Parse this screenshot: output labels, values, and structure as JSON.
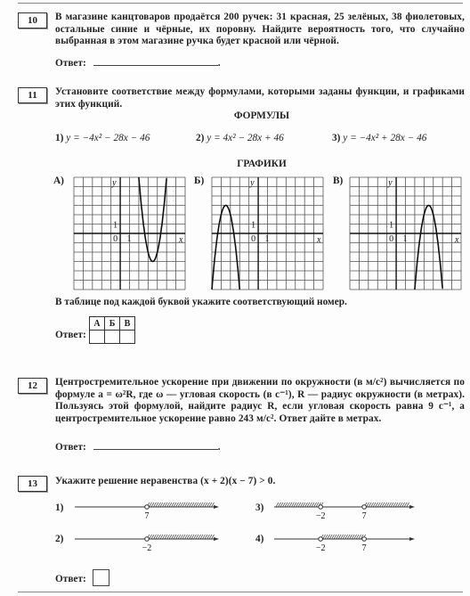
{
  "tasks": [
    {
      "number": "10",
      "text": "В магазине канцтоваров продаётся 200 ручек: 31 красная, 25 зелёных, 38 фиолетовых, остальные синие и чёрные, их поровну. Найдите вероятность того, что случайно выбранная в этом магазине ручка будет красной или чёрной.",
      "answer_label": "Ответ:"
    },
    {
      "number": "11",
      "text": "Установите соответствие между формулами, которыми заданы функции, и графиками этих функций.",
      "formulas_title": "ФОРМУЛЫ",
      "formulas": [
        {
          "n": "1)",
          "f": "y = −4x² − 28x − 46",
          "a": -4,
          "b": -28,
          "c": -46
        },
        {
          "n": "2)",
          "f": "y = 4x² − 28x + 46",
          "a": 4,
          "b": -28,
          "c": 46
        },
        {
          "n": "3)",
          "f": "y = −4x² + 28x − 46",
          "a": -4,
          "b": 28,
          "c": -46
        }
      ],
      "graphs_title": "ГРАФИКИ",
      "graphs": [
        {
          "label": "А)",
          "a": 4,
          "b": -28,
          "c": 46
        },
        {
          "label": "Б)",
          "a": -4,
          "b": -28,
          "c": -46
        },
        {
          "label": "В)",
          "a": -4,
          "b": 28,
          "c": -46
        }
      ],
      "axis": {
        "x": "x",
        "y": "y",
        "zero": "0",
        "one": "1",
        "xlim": [
          -5,
          7
        ],
        "ylim": [
          -6,
          6
        ]
      },
      "table_hint": "В таблице под каждой буквой укажите соответствующий номер.",
      "table_headers": [
        "А",
        "Б",
        "В"
      ],
      "answer_label": "Ответ:"
    },
    {
      "number": "12",
      "text": "Центростремительное ускорение при движении по окружности (в м/с²) вычисляется по формуле a = ω²R, где ω — угловая скорость (в с⁻¹), R — радиус окружности (в метрах). Пользуясь этой формулой, найдите радиус R, если угловая скорость равна 9 с⁻¹, а центростремительное ускорение равно 243 м/с². Ответ дайте в метрах.",
      "answer_label": "Ответ:"
    },
    {
      "number": "13",
      "text": "Укажите решение неравенства (x + 2)(x − 7) > 0.",
      "options": [
        {
          "n": "1)",
          "points": [
            "7"
          ],
          "shade": "right"
        },
        {
          "n": "2)",
          "points": [
            "−2"
          ],
          "shade": "right"
        },
        {
          "n": "3)",
          "points": [
            "−2",
            "7"
          ],
          "shade": "outer"
        },
        {
          "n": "4)",
          "points": [
            "−2",
            "7"
          ],
          "shade": "inner"
        }
      ],
      "answer_label": "Ответ:"
    }
  ]
}
